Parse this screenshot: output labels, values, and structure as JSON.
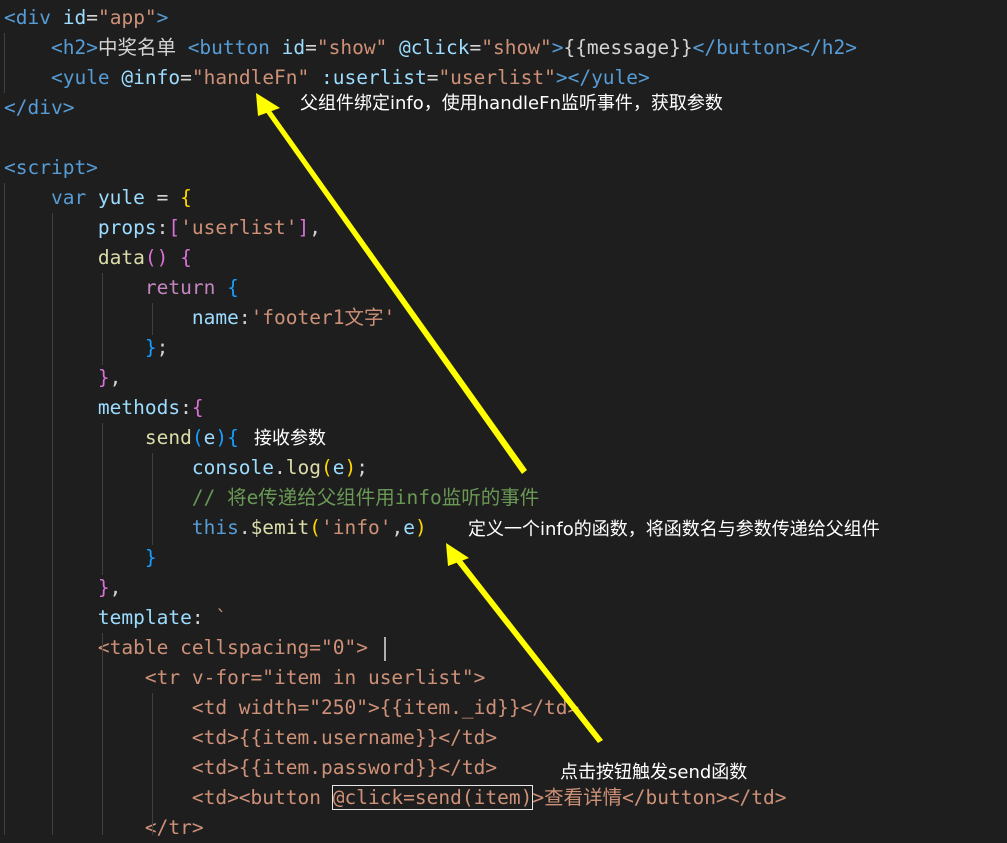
{
  "colors": {
    "background": "#1e1e1e",
    "tag": "#569cd6",
    "attr": "#9cdcfe",
    "string": "#ce9178",
    "text": "#d4d4d4",
    "keyword_purple": "#c586c0",
    "function": "#dcdcaa",
    "comment": "#6a9955",
    "bracket_gold": "#ffd700",
    "bracket_purple": "#da70d6",
    "bracket_blue": "#179fff",
    "arrow": "#ffff00"
  },
  "lines": [
    [
      {
        "t": "<",
        "c": "tag"
      },
      {
        "t": "div",
        "c": "tag"
      },
      {
        "t": " id",
        "c": "attr"
      },
      {
        "t": "=",
        "c": "text"
      },
      {
        "t": "\"app\"",
        "c": "string"
      },
      {
        "t": ">",
        "c": "tag"
      }
    ],
    [
      {
        "t": "    ",
        "c": "text"
      },
      {
        "t": "<h2>",
        "c": "tag"
      },
      {
        "t": "中奖名单 ",
        "c": "text"
      },
      {
        "t": "<button",
        "c": "tag"
      },
      {
        "t": " id",
        "c": "attr"
      },
      {
        "t": "=",
        "c": "text"
      },
      {
        "t": "\"show\"",
        "c": "string"
      },
      {
        "t": " @click",
        "c": "attr"
      },
      {
        "t": "=",
        "c": "text"
      },
      {
        "t": "\"show\"",
        "c": "string"
      },
      {
        "t": ">",
        "c": "tag"
      },
      {
        "t": "{{message}}",
        "c": "text"
      },
      {
        "t": "</button></h2>",
        "c": "tag"
      }
    ],
    [
      {
        "t": "    ",
        "c": "text"
      },
      {
        "t": "<yule",
        "c": "tag"
      },
      {
        "t": " @info",
        "c": "attr"
      },
      {
        "t": "=",
        "c": "text"
      },
      {
        "t": "\"handleFn\"",
        "c": "string"
      },
      {
        "t": " :userlist",
        "c": "attr"
      },
      {
        "t": "=",
        "c": "text"
      },
      {
        "t": "\"userlist\"",
        "c": "string"
      },
      {
        "t": "></yule>",
        "c": "tag"
      }
    ],
    [
      {
        "t": "</div>",
        "c": "tag"
      }
    ],
    [],
    [
      {
        "t": "<script>",
        "c": "tag"
      }
    ],
    [
      {
        "t": "    ",
        "c": "text"
      },
      {
        "t": "var",
        "c": "tag"
      },
      {
        "t": " yule ",
        "c": "attr"
      },
      {
        "t": "= ",
        "c": "text"
      },
      {
        "t": "{",
        "c": "bracket_gold"
      }
    ],
    [
      {
        "t": "        ",
        "c": "text"
      },
      {
        "t": "props",
        "c": "attr"
      },
      {
        "t": ":",
        "c": "text"
      },
      {
        "t": "[",
        "c": "bracket_purple"
      },
      {
        "t": "'userlist'",
        "c": "string"
      },
      {
        "t": "]",
        "c": "bracket_purple"
      },
      {
        "t": ",",
        "c": "text"
      }
    ],
    [
      {
        "t": "        ",
        "c": "text"
      },
      {
        "t": "data",
        "c": "function"
      },
      {
        "t": "()",
        "c": "bracket_purple"
      },
      {
        "t": " ",
        "c": "text"
      },
      {
        "t": "{",
        "c": "bracket_purple"
      }
    ],
    [
      {
        "t": "            ",
        "c": "text"
      },
      {
        "t": "return",
        "c": "keyword_purple"
      },
      {
        "t": " ",
        "c": "text"
      },
      {
        "t": "{",
        "c": "bracket_blue"
      }
    ],
    [
      {
        "t": "                ",
        "c": "text"
      },
      {
        "t": "name",
        "c": "attr"
      },
      {
        "t": ":",
        "c": "text"
      },
      {
        "t": "'footer1文字'",
        "c": "string"
      }
    ],
    [
      {
        "t": "            ",
        "c": "text"
      },
      {
        "t": "}",
        "c": "bracket_blue"
      },
      {
        "t": ";",
        "c": "text"
      }
    ],
    [
      {
        "t": "        ",
        "c": "text"
      },
      {
        "t": "}",
        "c": "bracket_purple"
      },
      {
        "t": ",",
        "c": "text"
      }
    ],
    [
      {
        "t": "        ",
        "c": "text"
      },
      {
        "t": "methods",
        "c": "attr"
      },
      {
        "t": ":",
        "c": "text"
      },
      {
        "t": "{",
        "c": "bracket_purple"
      }
    ],
    [
      {
        "t": "            ",
        "c": "text"
      },
      {
        "t": "send",
        "c": "function"
      },
      {
        "t": "(",
        "c": "bracket_blue"
      },
      {
        "t": "e",
        "c": "attr"
      },
      {
        "t": ")",
        "c": "bracket_blue"
      },
      {
        "t": "{",
        "c": "bracket_blue"
      }
    ],
    [
      {
        "t": "                ",
        "c": "text"
      },
      {
        "t": "console",
        "c": "attr"
      },
      {
        "t": ".",
        "c": "text"
      },
      {
        "t": "log",
        "c": "function"
      },
      {
        "t": "(",
        "c": "bracket_gold"
      },
      {
        "t": "e",
        "c": "attr"
      },
      {
        "t": ")",
        "c": "bracket_gold"
      },
      {
        "t": ";",
        "c": "text"
      }
    ],
    [
      {
        "t": "                ",
        "c": "text"
      },
      {
        "t": "// 将e传递给父组件用info监听的事件",
        "c": "comment"
      }
    ],
    [
      {
        "t": "                ",
        "c": "text"
      },
      {
        "t": "this",
        "c": "tag"
      },
      {
        "t": ".",
        "c": "text"
      },
      {
        "t": "$emit",
        "c": "function"
      },
      {
        "t": "(",
        "c": "bracket_gold"
      },
      {
        "t": "'info'",
        "c": "string"
      },
      {
        "t": ",",
        "c": "text"
      },
      {
        "t": "e",
        "c": "attr"
      },
      {
        "t": ")",
        "c": "bracket_gold"
      }
    ],
    [
      {
        "t": "            ",
        "c": "text"
      },
      {
        "t": "}",
        "c": "bracket_blue"
      }
    ],
    [
      {
        "t": "        ",
        "c": "text"
      },
      {
        "t": "}",
        "c": "bracket_purple"
      },
      {
        "t": ",",
        "c": "text"
      }
    ],
    [
      {
        "t": "        ",
        "c": "text"
      },
      {
        "t": "template",
        "c": "attr"
      },
      {
        "t": ": ",
        "c": "text"
      },
      {
        "t": "`",
        "c": "string"
      }
    ],
    [
      {
        "t": "        ",
        "c": "text"
      },
      {
        "t": "<table cellspacing=\"0\">",
        "c": "string"
      }
    ],
    [
      {
        "t": "            ",
        "c": "text"
      },
      {
        "t": "<tr v-for=\"item in userlist\">",
        "c": "string"
      }
    ],
    [
      {
        "t": "                ",
        "c": "text"
      },
      {
        "t": "<td width=\"250\">{{item._id}}</td>",
        "c": "string"
      }
    ],
    [
      {
        "t": "                ",
        "c": "text"
      },
      {
        "t": "<td>{{item.username}}</td>",
        "c": "string"
      }
    ],
    [
      {
        "t": "                ",
        "c": "text"
      },
      {
        "t": "<td>{{item.password}}</td>",
        "c": "string"
      }
    ],
    [
      {
        "t": "                ",
        "c": "text"
      },
      {
        "t": "<td><button ",
        "c": "string"
      },
      {
        "t": "@click=send(item)",
        "c": "string",
        "box": true
      },
      {
        "t": ">查看详情</button></td>",
        "c": "string"
      }
    ],
    [
      {
        "t": "            ",
        "c": "text"
      },
      {
        "t": "</tr>",
        "c": "string"
      }
    ]
  ],
  "annotations": {
    "note1": "父组件绑定info，使用handleFn监听事件，获取参数",
    "note2": "接收参数",
    "note3": "定义一个info的函数，将函数名与参数传递给父组件",
    "note4": "点击按钮触发send函数"
  }
}
